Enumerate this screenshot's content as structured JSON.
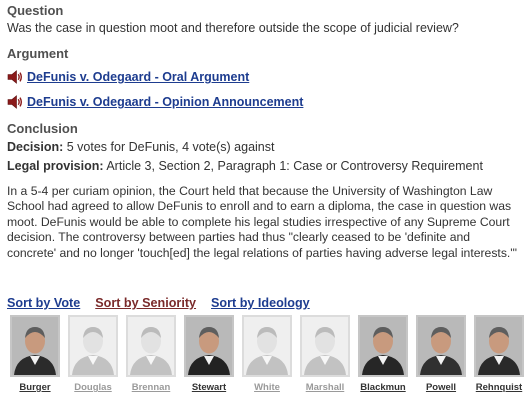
{
  "question": {
    "heading": "Question",
    "text": "Was the case in question moot and therefore outside the scope of judicial review?"
  },
  "argument": {
    "heading": "Argument",
    "links": [
      {
        "label": "DeFunis v. Odegaard - Oral Argument",
        "icon": "speaker-icon"
      },
      {
        "label": "DeFunis v. Odegaard - Opinion Announcement",
        "icon": "speaker-icon"
      }
    ]
  },
  "conclusion": {
    "heading": "Conclusion",
    "decision_label": "Decision:",
    "decision_value": "5 votes for DeFunis, 4 vote(s) against",
    "legal_label": "Legal provision:",
    "legal_value": "Article 3, Section 2, Paragraph 1: Case or Controversy Requirement",
    "opinion_text": "In a 5-4 per curiam opinion, the Court held that because the University of Washington Law School had agreed to allow DeFunis to enroll and to earn a diploma, the case in question was moot. DeFunis would be able to complete his legal studies irrespective of any Supreme Court decision. The controversy between parties had thus \"clearly ceased to be 'definite and concrete' and no longer 'touch[ed] the legal relations of parties having adverse legal interests.'\""
  },
  "sort": {
    "vote": "Sort by Vote",
    "seniority": "Sort by Seniority",
    "ideology": "Sort by Ideology"
  },
  "justices": [
    {
      "name": "Burger",
      "side": "majority"
    },
    {
      "name": "Douglas",
      "side": "dissent"
    },
    {
      "name": "Brennan",
      "side": "dissent"
    },
    {
      "name": "Stewart",
      "side": "majority"
    },
    {
      "name": "White",
      "side": "dissent"
    },
    {
      "name": "Marshall",
      "side": "dissent"
    },
    {
      "name": "Blackmun",
      "side": "majority"
    },
    {
      "name": "Powell",
      "side": "majority"
    },
    {
      "name": "Rehnquist",
      "side": "majority"
    }
  ],
  "colors": {
    "link": "#1d3c8f",
    "seniority_link": "#7a2a2a",
    "heading": "#505050",
    "dissent_name": "#9a9a9a"
  }
}
